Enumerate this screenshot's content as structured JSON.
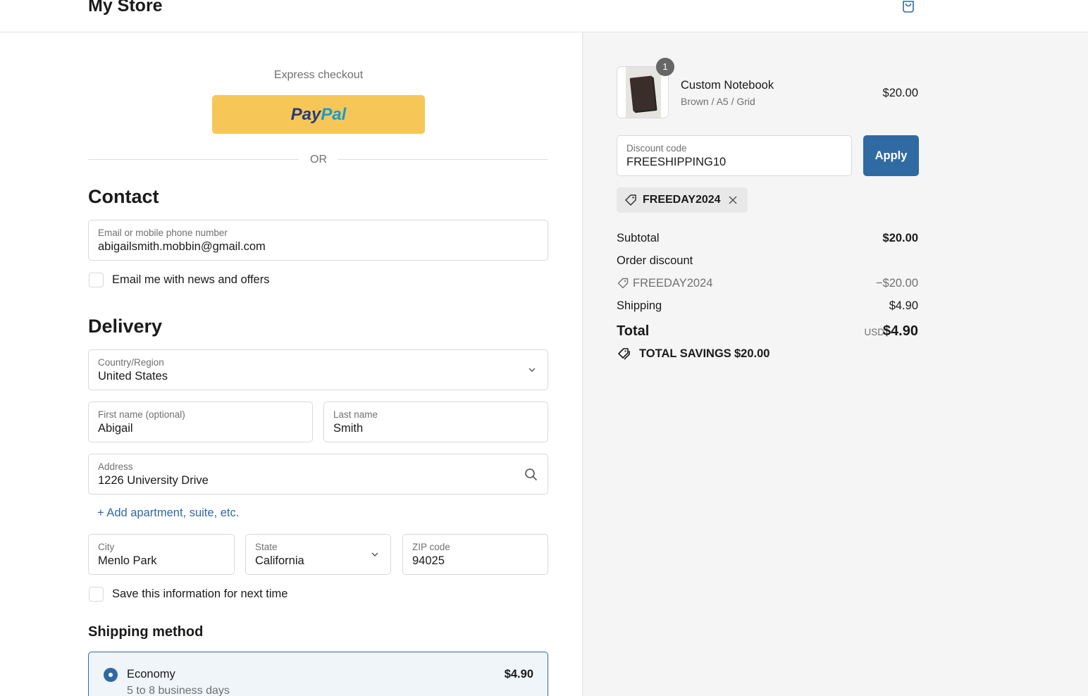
{
  "header": {
    "store_name": "My Store",
    "cart_icon": "shopping-bag-icon"
  },
  "express": {
    "label": "Express checkout",
    "paypal_part1": "Pay",
    "paypal_part2": "Pal",
    "or_text": "OR"
  },
  "contact": {
    "heading": "Contact",
    "email_label": "Email or mobile phone number",
    "email_value": "abigailsmith.mobbin@gmail.com",
    "newsletter_label": "Email me with news and offers"
  },
  "delivery": {
    "heading": "Delivery",
    "country_label": "Country/Region",
    "country_value": "United States",
    "first_name_label": "First name (optional)",
    "first_name_value": "Abigail",
    "last_name_label": "Last name",
    "last_name_value": "Smith",
    "address_label": "Address",
    "address_value": "1226 University Drive",
    "add_apartment": "+ Add apartment, suite, etc.",
    "city_label": "City",
    "city_value": "Menlo Park",
    "state_label": "State",
    "state_value": "California",
    "zip_label": "ZIP code",
    "zip_value": "94025",
    "save_info_label": "Save this information for next time"
  },
  "shipping": {
    "heading": "Shipping method",
    "option_name": "Economy",
    "option_sub": "5 to 8 business days",
    "option_price": "$4.90"
  },
  "order": {
    "product": {
      "quantity": "1",
      "name": "Custom Notebook",
      "variant": "Brown / A5 / Grid",
      "price": "$20.00"
    },
    "discount_label": "Discount code",
    "discount_value": "FREESHIPPING10",
    "apply_label": "Apply",
    "applied_code": "FREEDAY2024",
    "subtotal_label": "Subtotal",
    "subtotal_value": "$20.00",
    "order_discount_label": "Order discount",
    "discount_line_code": "FREEDAY2024",
    "discount_line_value": "−$20.00",
    "shipping_label": "Shipping",
    "shipping_value": "$4.90",
    "total_label": "Total",
    "total_currency": "USD",
    "total_value": "$4.90",
    "savings_label": "TOTAL SAVINGS",
    "savings_value": "$20.00"
  },
  "colors": {
    "accent": "#2f6aa3",
    "paypal_yellow": "#f6c757",
    "panel_bg": "#f5f5f5"
  }
}
